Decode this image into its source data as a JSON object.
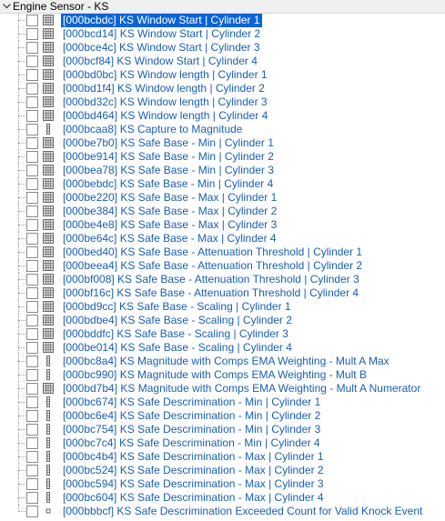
{
  "group": {
    "title": "Engine Sensor - KS"
  },
  "items": [
    {
      "label": "[000bcbdc] KS Window Start | Cylinder 1",
      "icon": "table-grid-icon",
      "selected": true
    },
    {
      "label": "[000bcd14] KS Window Start | Cylinder 2",
      "icon": "table-grid-icon"
    },
    {
      "label": "[000bce4c] KS Window Start | Cylinder 3",
      "icon": "table-grid-icon"
    },
    {
      "label": "[000bcf84] KS Window Start | Cylinder 4",
      "icon": "table-grid-icon"
    },
    {
      "label": "[000bd0bc] KS Window length | Cylinder 1",
      "icon": "table-grid-icon"
    },
    {
      "label": "[000bd1f4] KS Window length | Cylinder 2",
      "icon": "table-grid-icon"
    },
    {
      "label": "[000bd32c] KS Window length | Cylinder 3",
      "icon": "table-grid-icon"
    },
    {
      "label": "[000bd464] KS Window length | Cylinder 4",
      "icon": "table-grid-icon"
    },
    {
      "label": "[000bcaa8] KS Capture to Magnitude",
      "icon": "column-icon"
    },
    {
      "label": "[000be7b0] KS Safe Base - Min | Cylinder 1",
      "icon": "table-grid-icon"
    },
    {
      "label": "[000be914] KS Safe Base - Min | Cylinder 2",
      "icon": "table-grid-icon"
    },
    {
      "label": "[000bea78] KS Safe Base - Min | Cylinder 3",
      "icon": "table-grid-icon"
    },
    {
      "label": "[000bebdc] KS Safe Base - Min | Cylinder 4",
      "icon": "table-grid-icon"
    },
    {
      "label": "[000be220] KS Safe Base - Max | Cylinder 1",
      "icon": "table-grid-icon"
    },
    {
      "label": "[000be384] KS Safe Base - Max | Cylinder 2",
      "icon": "table-grid-icon"
    },
    {
      "label": "[000be4e8] KS Safe Base - Max | Cylinder 3",
      "icon": "table-grid-icon"
    },
    {
      "label": "[000be64c] KS Safe Base - Max | Cylinder 4",
      "icon": "table-grid-icon"
    },
    {
      "label": "[000bed40] KS Safe Base - Attenuation Threshold | Cylinder 1",
      "icon": "table-grid-icon"
    },
    {
      "label": "[000beea4] KS Safe Base - Attenuation Threshold | Cylinder 2",
      "icon": "table-grid-icon"
    },
    {
      "label": "[000bf008] KS Safe Base - Attenuation Threshold | Cylinder 3",
      "icon": "table-grid-icon"
    },
    {
      "label": "[000bf16c] KS Safe Base - Attenuation Threshold | Cylinder 4",
      "icon": "table-grid-icon"
    },
    {
      "label": "[000bd9cc] KS Safe Base - Scaling | Cylinder 1",
      "icon": "table-grid-icon"
    },
    {
      "label": "[000bdbe4] KS Safe Base - Scaling | Cylinder 2",
      "icon": "table-grid-icon"
    },
    {
      "label": "[000bddfc] KS Safe Base - Scaling | Cylinder 3",
      "icon": "table-grid-icon"
    },
    {
      "label": "[000be014] KS Safe Base - Scaling | Cylinder 4",
      "icon": "table-grid-icon"
    },
    {
      "label": "[000bc8a4] KS Magnitude with Comps EMA Weighting - Mult A Max",
      "icon": "column-icon"
    },
    {
      "label": "[000bc990] KS Magnitude with Comps EMA Weighting - Mult B",
      "icon": "column-icon"
    },
    {
      "label": "[000bd7b4] KS Magnitude with Comps EMA Weighting - Mult A Numerator",
      "icon": "table-grid-icon"
    },
    {
      "label": "[000bc674] KS Safe Descrimination - Min | Cylinder 1",
      "icon": "column-icon"
    },
    {
      "label": "[000bc6e4] KS Safe Descrimination - Min | Cylinder 2",
      "icon": "column-icon"
    },
    {
      "label": "[000bc754] KS Safe Descrimination - Min | Cylinder 3",
      "icon": "column-icon"
    },
    {
      "label": "[000bc7c4] KS Safe Descrimination - Min | Cylinder 4",
      "icon": "column-icon"
    },
    {
      "label": "[000bc4b4] KS Safe Descrimination - Max | Cylinder 1",
      "icon": "column-icon"
    },
    {
      "label": "[000bc524] KS Safe Descrimination - Max | Cylinder 2",
      "icon": "column-icon"
    },
    {
      "label": "[000bc594] KS Safe Descrimination - Max | Cylinder 3",
      "icon": "column-icon"
    },
    {
      "label": "[000bc604] KS Safe Descrimination - Max | Cylinder 4",
      "icon": "column-icon"
    },
    {
      "label": "[000bbbcf] KS Safe Descrimination Exceeded Count for Valid Knock Event",
      "icon": "scalar-icon"
    }
  ],
  "colors": {
    "link": "#1a5fb4",
    "selection": "#0a64d6",
    "header_bg": "#f0f0f0"
  }
}
